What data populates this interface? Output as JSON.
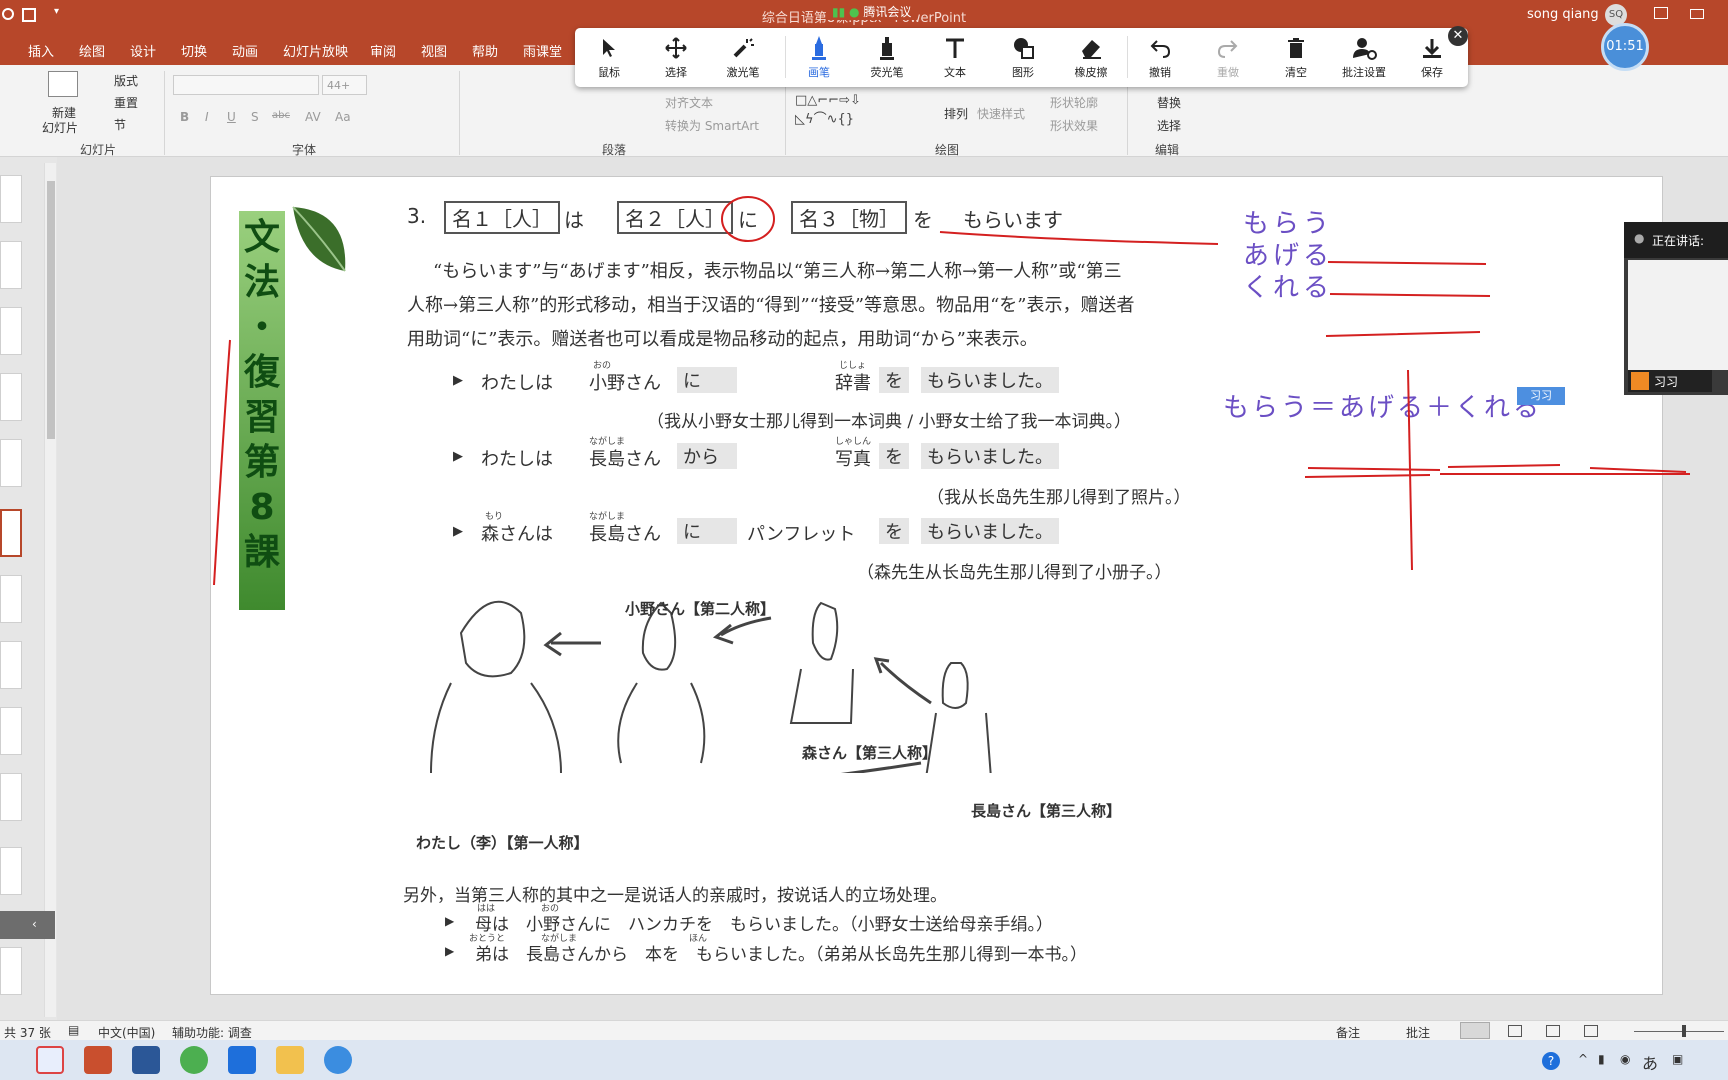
{
  "app": {
    "title": "综合日语第8课.pptx - PowerPoint",
    "overlay_title": "腾讯会议",
    "user": "song qiang",
    "user_initials": "SQ"
  },
  "tabs": [
    "插入",
    "绘图",
    "设计",
    "切换",
    "动画",
    "幻灯片放映",
    "审阅",
    "视图",
    "帮助",
    "雨课堂"
  ],
  "ribbon": {
    "slides_group": {
      "new_slide": "新建",
      "new_slide2": "幻灯片",
      "layout": "版式",
      "reset": "重置",
      "section": "节",
      "label": "幻灯片"
    },
    "font_group": {
      "font_size": "44+",
      "label": "字体",
      "bold": "B",
      "italic": "I",
      "underline": "U",
      "shadow": "S",
      "strike": "abc",
      "spacing": "AV",
      "case": "Aa"
    },
    "paragraph_group": {
      "align_text": "对齐文本",
      "convert_smartart": "转换为 SmartArt",
      "label": "段落"
    },
    "drawing_group": {
      "arrange": "排列",
      "quick_styles": "快速样式",
      "shape_outline": "形状轮廓",
      "shape_effects": "形状效果",
      "label": "绘图"
    },
    "editing_group": {
      "replace": "替换",
      "select": "选择",
      "label": "编辑"
    }
  },
  "annotation_toolbar": {
    "tools": [
      {
        "label": "鼠标",
        "icon": "cursor-icon"
      },
      {
        "label": "选择",
        "icon": "move-icon"
      },
      {
        "label": "激光笔",
        "icon": "laser-icon"
      },
      {
        "label": "画笔",
        "icon": "pen-icon"
      },
      {
        "label": "荧光笔",
        "icon": "highlighter-icon"
      },
      {
        "label": "文本",
        "icon": "text-icon"
      },
      {
        "label": "图形",
        "icon": "shape-icon"
      },
      {
        "label": "橡皮擦",
        "icon": "eraser-icon"
      },
      {
        "label": "撤销",
        "icon": "undo-icon"
      },
      {
        "label": "重做",
        "icon": "redo-icon"
      },
      {
        "label": "清空",
        "icon": "trash-icon"
      },
      {
        "label": "批注设置",
        "icon": "annotate-settings-icon"
      },
      {
        "label": "保存",
        "icon": "download-icon"
      }
    ],
    "active": "画笔",
    "timer": "01:51"
  },
  "meeting": {
    "speaking": "正在讲话:",
    "participant": "习习",
    "cursor_tag": "习习"
  },
  "slide": {
    "side_title": [
      "文",
      "法",
      "・",
      "復",
      "習",
      "第",
      "8",
      "課"
    ],
    "heading": {
      "num": "3.",
      "n1": "名１［人］",
      "wa": "は",
      "n2": "名２［人］",
      "ni": "に",
      "n3": "名３［物］",
      "wo": "を",
      "verb": "もらいます"
    },
    "para": [
      "“もらいます”与“あげます”相反，表示物品以“第三人称→第二人称→第一人称”或“第三",
      "人称→第三人称”的形式移动，相当于汉语的“得到”“接受”等意思。物品用“を”表示，赠送者",
      "用助词“に”表示。赠送者也可以看成是物品移动的起点，用助词“から”来表示。"
    ],
    "examples": [
      {
        "subj": "わたしは",
        "giver": "小野さん",
        "giver_ruby": "おの",
        "part": "に",
        "obj": "辞書",
        "obj_ruby": "じしょ",
        "wo": "を",
        "verb": "もらいました。",
        "trans": "（我从小野女士那儿得到一本词典 / 小野女士给了我一本词典。）"
      },
      {
        "subj": "わたしは",
        "giver": "長島さん",
        "giver_ruby": "ながしま",
        "part": "から",
        "obj": "写真",
        "obj_ruby": "しゃしん",
        "wo": "を",
        "verb": "もらいました。",
        "trans": "（我从长岛先生那儿得到了照片。）"
      },
      {
        "subj": "森さんは",
        "subj_ruby": "もり",
        "giver": "長島さん",
        "giver_ruby": "ながしま",
        "part": "に",
        "obj": "パンフレット",
        "wo": "を",
        "verb": "もらいました。",
        "trans": "（森先生从长岛先生那儿得到了小册子。）"
      }
    ],
    "figure_labels": {
      "ono": "小野さん【第二人称】",
      "mori": "森さん【第三人称】",
      "nagashima": "長島さん【第三人称】",
      "watashi": "わたし（李）【第一人称】"
    },
    "note": "另外，当第三人称的其中之一是说话人的亲戚时，按说话人的立场处理。",
    "note_examples": [
      {
        "line": "母は　小野さんに　ハンカチを　もらいました。（小野女士送给母亲手绢。）",
        "ruby1": "はは",
        "ruby2": "おの"
      },
      {
        "line": "弟は　長島さんから　本を　もらいました。（弟弟从长岛先生那儿得到一本书。）",
        "ruby1": "おとうと",
        "ruby2": "ながしま",
        "ruby3": "ほん"
      }
    ],
    "handwriting": {
      "w1": "もらう",
      "w2": "あげる",
      "w3": "くれる",
      "eq": "もらう＝あげる＋くれる"
    }
  },
  "status": {
    "slide_count": "共 37 张",
    "language": "中文(中国)",
    "accessibility": "辅助功能: 调查",
    "notes": "备注",
    "comments": "批注"
  },
  "colors": {
    "ppt_red": "#b7472a",
    "pen_purple": "#6b4fc4",
    "ink_red": "#d42020",
    "title_green": "#3f8a2e"
  }
}
